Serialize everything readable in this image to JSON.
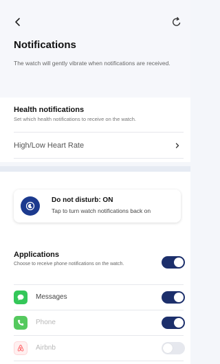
{
  "header": {
    "title": "Notifications",
    "subtitle": "The watch will gently vibrate when notifications are received.",
    "back_icon": "chevron-left-icon",
    "refresh_icon": "refresh-icon"
  },
  "health": {
    "title": "Health notifications",
    "subtitle": "Set which health notifications to receive on the watch.",
    "items": [
      {
        "label": "High/Low Heart Rate"
      }
    ]
  },
  "dnd": {
    "title": "Do not disturb: ON",
    "subtitle": "Tap to turn watch notifications back on",
    "icon": "do-not-disturb-icon",
    "icon_color": "#1c3a8e"
  },
  "applications": {
    "title": "Applications",
    "subtitle": "Choose to receive phone notifications on the watch.",
    "master_enabled": true,
    "apps": [
      {
        "label": "Messages",
        "icon": "messages-icon",
        "icon_color": "#34c759",
        "label_color": "#444444",
        "enabled": true
      },
      {
        "label": "Phone",
        "icon": "phone-icon",
        "icon_color": "#55c95e",
        "label_color": "#b8b8b8",
        "enabled": true
      },
      {
        "label": "Airbnb",
        "icon": "airbnb-icon",
        "icon_color": "#ff5a5f",
        "label_color": "#b8b8b8",
        "enabled": false
      }
    ]
  },
  "colors": {
    "toggle_on": "#1c2f6b",
    "toggle_off": "#e6e8ee",
    "background": "#f4f6fa"
  }
}
